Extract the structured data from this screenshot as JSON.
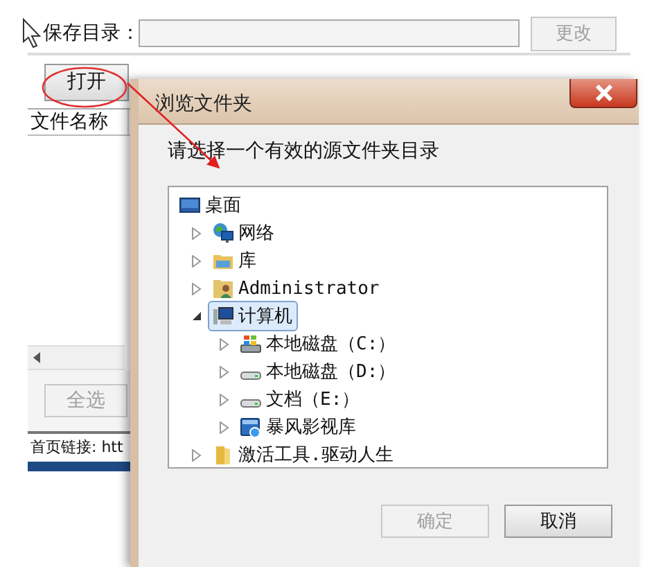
{
  "app": {
    "save_dir": {
      "label": "保存目录：",
      "change_button": {
        "label": "更改",
        "disabled": true
      }
    },
    "open_button": {
      "label": "打开",
      "disabled": false
    },
    "file_list": {
      "columns": [
        "文件名称"
      ]
    },
    "select_all_button": {
      "label": "全选",
      "disabled": true
    },
    "status_text": "首页链接: htt"
  },
  "dialog": {
    "title": "浏览文件夹",
    "prompt": "请选择一个有效的源文件夹目录",
    "tree": [
      {
        "label": "桌面",
        "kind": "desktop",
        "selected": false,
        "children": [
          {
            "label": "网络",
            "kind": "network",
            "expanded": false,
            "selected": false
          },
          {
            "label": "库",
            "kind": "library",
            "expanded": false,
            "selected": false
          },
          {
            "label": "Administrator",
            "kind": "user",
            "expanded": false,
            "selected": false
          },
          {
            "label": "计算机",
            "kind": "computer",
            "expanded": true,
            "selected": true,
            "children": [
              {
                "label": "本地磁盘（C:）",
                "kind": "system-drive",
                "expanded": false,
                "selected": false
              },
              {
                "label": "本地磁盘（D:）",
                "kind": "drive",
                "expanded": false,
                "selected": false
              },
              {
                "label": "文档（E:）",
                "kind": "drive",
                "expanded": false,
                "selected": false
              },
              {
                "label": "暴风影视库",
                "kind": "media",
                "expanded": false,
                "selected": false
              }
            ]
          },
          {
            "label": "激活工具.驱动人生",
            "kind": "folder",
            "expanded": false,
            "selected": false
          }
        ]
      }
    ],
    "buttons": [
      {
        "label": "确定",
        "disabled": true
      },
      {
        "label": "取消",
        "disabled": false
      }
    ]
  }
}
